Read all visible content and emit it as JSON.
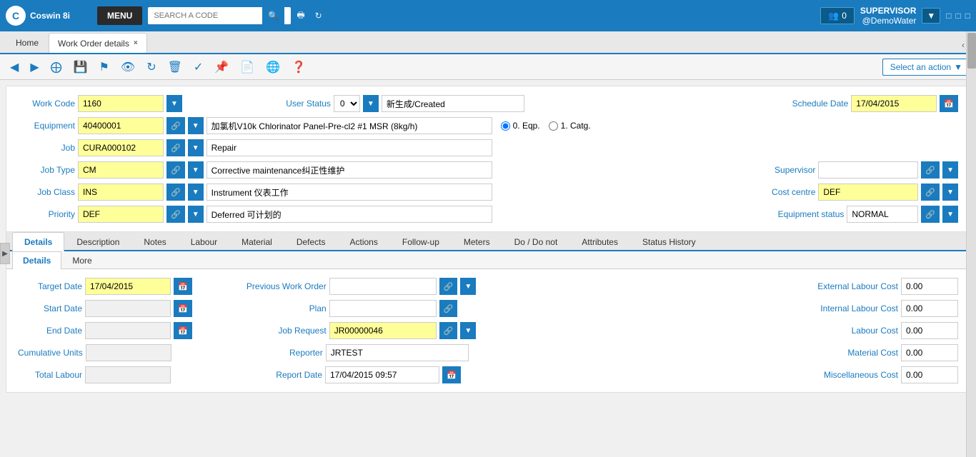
{
  "app": {
    "logo_text": "Coswin 8i",
    "menu_btn": "MENU",
    "search_placeholder": "SEARCH A CODE"
  },
  "user": {
    "role": "SUPERVISOR",
    "account": "@DemoWater",
    "notification_count": "0"
  },
  "tabs": {
    "home": "Home",
    "work_order": "Work Order details",
    "close_tab": "×"
  },
  "toolbar": {
    "action_btn": "Select an action",
    "nav_left": "‹",
    "nav_right": "›"
  },
  "form": {
    "work_code_label": "Work Code",
    "work_code_value": "1160",
    "user_status_label": "User Status",
    "user_status_value": "0",
    "user_status_text": "新生成/Created",
    "schedule_date_label": "Schedule Date",
    "schedule_date_value": "17/04/2015",
    "equipment_label": "Equipment",
    "equipment_value": "40400001",
    "equipment_desc": "加氯机V10k Chlorinator Panel-Pre-cl2 #1 MSR (8kg/h)",
    "eqp_radio": "0. Eqp.",
    "catg_radio": "1. Catg.",
    "job_label": "Job",
    "job_value": "CURA000102",
    "job_desc": "Repair",
    "job_type_label": "Job Type",
    "job_type_value": "CM",
    "job_type_desc": "Corrective maintenance纠正性维护",
    "supervisor_label": "Supervisor",
    "supervisor_value": "",
    "job_class_label": "Job Class",
    "job_class_value": "INS",
    "job_class_desc": "Instrument 仪表工作",
    "cost_centre_label": "Cost centre",
    "cost_centre_value": "DEF",
    "priority_label": "Priority",
    "priority_value": "DEF",
    "priority_desc": "Deferred 可计划的",
    "equipment_status_label": "Equipment status",
    "equipment_status_value": "NORMAL"
  },
  "sub_tabs": {
    "tabs": [
      "Details",
      "Description",
      "Notes",
      "Labour",
      "Material",
      "Defects",
      "Actions",
      "Follow-up",
      "Meters",
      "Do / Do not",
      "Attributes",
      "Status History"
    ]
  },
  "sub_tabs2": {
    "tabs": [
      "Details",
      "More"
    ]
  },
  "detail_form": {
    "target_date_label": "Target Date",
    "target_date_value": "17/04/2015",
    "prev_wo_label": "Previous Work Order",
    "prev_wo_value": "",
    "ext_labour_label": "External Labour Cost",
    "ext_labour_value": "0.00",
    "start_date_label": "Start Date",
    "start_date_value": "",
    "plan_label": "Plan",
    "plan_value": "",
    "int_labour_label": "Internal Labour Cost",
    "int_labour_value": "0.00",
    "end_date_label": "End Date",
    "end_date_value": "",
    "job_request_label": "Job Request",
    "job_request_value": "JR00000046",
    "labour_cost_label": "Labour Cost",
    "labour_cost_value": "0.00",
    "cumul_units_label": "Cumulative Units",
    "cumul_units_value": "",
    "reporter_label": "Reporter",
    "reporter_value": "JRTEST",
    "material_cost_label": "Material Cost",
    "material_cost_value": "0.00",
    "total_labour_label": "Total Labour",
    "total_labour_value": "",
    "report_date_label": "Report Date",
    "report_date_value": "17/04/2015 09:57",
    "misc_cost_label": "Miscellaneous Cost",
    "misc_cost_value": "0.00"
  }
}
